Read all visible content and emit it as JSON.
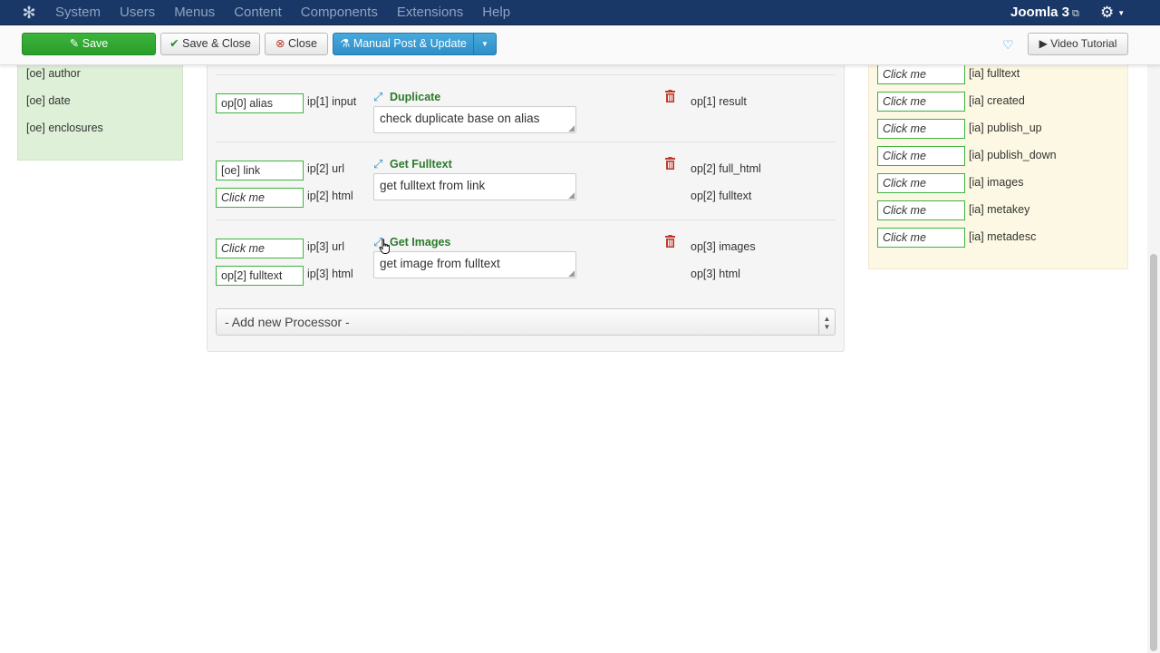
{
  "navbar": {
    "menu": [
      "System",
      "Users",
      "Menus",
      "Content",
      "Components",
      "Extensions",
      "Help"
    ],
    "site_name": "Joomla 3"
  },
  "toolbar": {
    "save": "Save",
    "save_close": "Save & Close",
    "close": "Close",
    "manual": "Manual Post & Update",
    "video": "Video Tutorial"
  },
  "left_panel": {
    "items": [
      "[oe] author",
      "[oe] date",
      "[oe] enclosures"
    ]
  },
  "processors": [
    {
      "title": "Duplicate",
      "description": "check duplicate base on alias",
      "inputs": [
        {
          "value": "op[0] alias",
          "label": "ip[1] input"
        }
      ],
      "outputs": [
        "op[1] result"
      ]
    },
    {
      "title": "Get Fulltext",
      "description": "get fulltext from link",
      "inputs": [
        {
          "value": "[oe] link",
          "label": "ip[2] url"
        },
        {
          "value": "Click me",
          "label": "ip[2] html"
        }
      ],
      "outputs": [
        "op[2] full_html",
        "op[2] fulltext"
      ]
    },
    {
      "title": "Get Images",
      "description": "get image from fulltext",
      "inputs": [
        {
          "value": "Click me",
          "label": "ip[3] url"
        },
        {
          "value": "op[2] fulltext",
          "label": "ip[3] html"
        }
      ],
      "outputs": [
        "op[3] images",
        "op[3] html"
      ]
    }
  ],
  "add_processor": "- Add new Processor -",
  "right_panel": {
    "rows": [
      {
        "value": "Click me",
        "label": "[ia] fulltext"
      },
      {
        "value": "Click me",
        "label": "[ia] created"
      },
      {
        "value": "Click me",
        "label": "[ia] publish_up"
      },
      {
        "value": "Click me",
        "label": "[ia] publish_down"
      },
      {
        "value": "Click me",
        "label": "[ia] images"
      },
      {
        "value": "Click me",
        "label": "[ia] metakey"
      },
      {
        "value": "Click me",
        "label": "[ia] metadesc"
      }
    ]
  },
  "colors": {
    "navbar": "#1a3867",
    "save_green": "#2a9d2a",
    "manual_blue": "#2d8fc9",
    "field_border": "#3db33d",
    "left_panel_bg": "#dff0d8",
    "right_panel_bg": "#fcf8e3",
    "title_green": "#2b7a2b",
    "trash_red": "#c0392b"
  },
  "icons": [
    "joomla-logo-icon",
    "external-link-icon",
    "gear-icon",
    "check-icon",
    "remove-icon",
    "flask-icon",
    "heart-icon",
    "video-icon",
    "expand-icon",
    "trash-icon",
    "select-arrows-icon"
  ]
}
